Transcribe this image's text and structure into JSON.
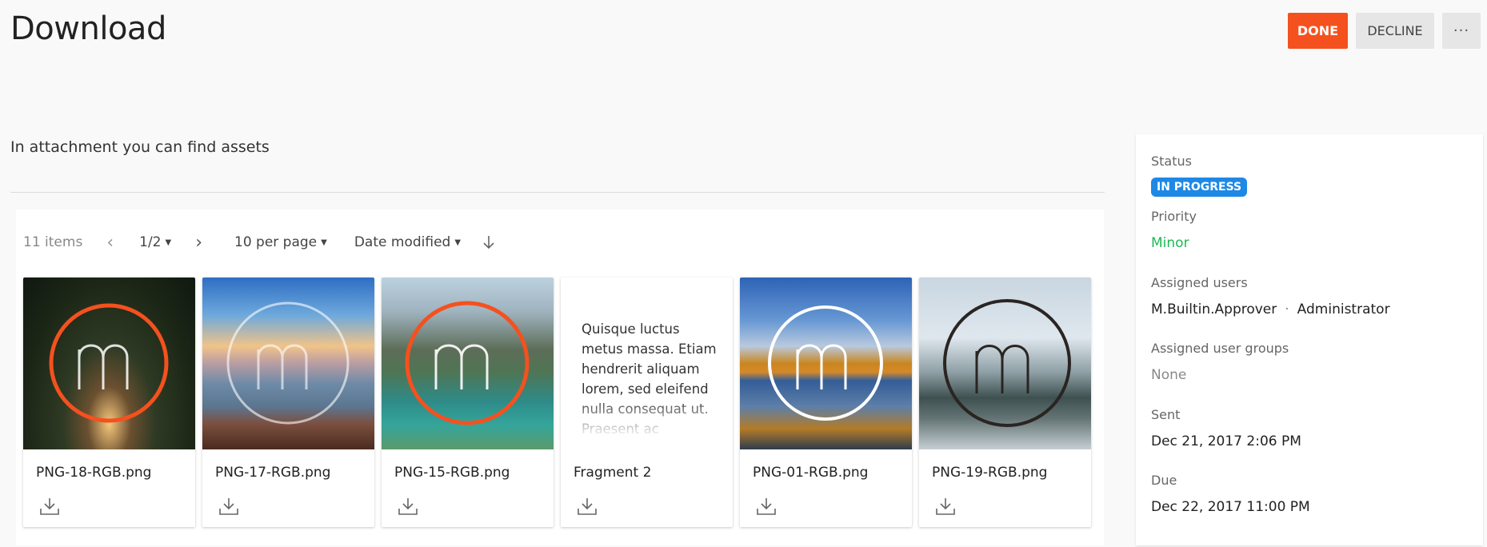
{
  "header": {
    "title": "Download",
    "done_label": "DONE",
    "decline_label": "DECLINE",
    "more_label": "···"
  },
  "description": "In attachment you can find assets",
  "toolbar": {
    "items_count": "11 items",
    "page": "1/2",
    "per_page": "10 per page",
    "sort_by": "Date modified"
  },
  "cards": [
    {
      "name": "PNG-18-RGB.png",
      "ring_color": "#f4511e"
    },
    {
      "name": "PNG-17-RGB.png",
      "ring_color": "#ffffff"
    },
    {
      "name": "PNG-15-RGB.png",
      "ring_color": "#f4511e"
    },
    {
      "name": "Fragment 2",
      "text": "Quisque luctus metus massa. Etiam hendrerit aliquam lorem, sed eleifend nulla consequat ut. Praesent ac"
    },
    {
      "name": "PNG-01-RGB.png",
      "ring_color": "#ffffff"
    },
    {
      "name": "PNG-19-RGB.png",
      "ring_color": "#2a2522"
    }
  ],
  "sidebar": {
    "status_label": "Status",
    "status_value": "IN PROGRESS",
    "priority_label": "Priority",
    "priority_value": "Minor",
    "assigned_users_label": "Assigned users",
    "assigned_user_1": "M.Builtin.Approver",
    "assigned_user_2": "Administrator",
    "assigned_groups_label": "Assigned user groups",
    "assigned_groups_value": "None",
    "sent_label": "Sent",
    "sent_value": "Dec 21, 2017 2:06 PM",
    "due_label": "Due",
    "due_value": "Dec 22, 2017 11:00 PM"
  },
  "colors": {
    "accent": "#f4511e",
    "status_badge": "#1e88e5",
    "priority": "#1db954"
  }
}
